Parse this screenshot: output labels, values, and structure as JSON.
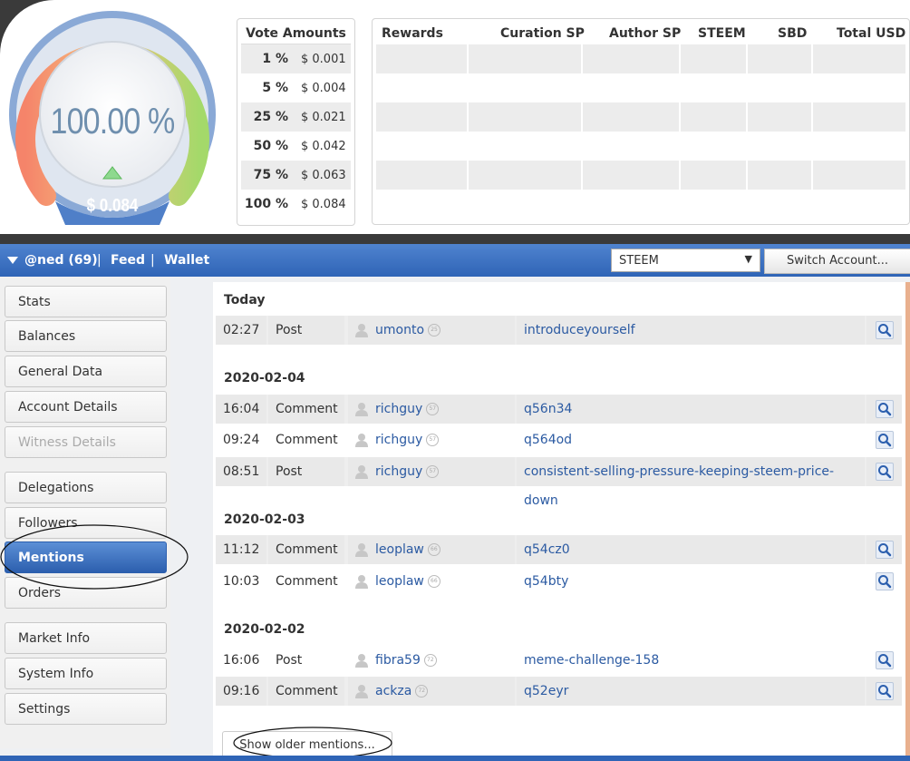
{
  "gauge": {
    "percent": "100.00 %",
    "usd": "$ 0.084",
    "arrow": "up-arrow"
  },
  "vote_amounts": {
    "title": "Vote Amounts",
    "rows": [
      {
        "pct": "1 %",
        "val": "$ 0.001"
      },
      {
        "pct": "5 %",
        "val": "$ 0.004"
      },
      {
        "pct": "25 %",
        "val": "$ 0.021"
      },
      {
        "pct": "50 %",
        "val": "$ 0.042"
      },
      {
        "pct": "75 %",
        "val": "$ 0.063"
      },
      {
        "pct": "100 %",
        "val": "$ 0.084"
      }
    ]
  },
  "rewards": {
    "headers": [
      "Rewards",
      "Curation SP",
      "Author SP",
      "STEEM",
      "SBD",
      "Total USD"
    ]
  },
  "nav": {
    "account": "@ned (69)",
    "sep": "|",
    "feed": "Feed",
    "wallet": "Wallet",
    "coin_selected": "STEEM",
    "switch_label": "Switch Account..."
  },
  "sidebar": {
    "items": [
      {
        "label": "Stats"
      },
      {
        "label": "Balances"
      },
      {
        "label": "General Data"
      },
      {
        "label": "Account Details"
      },
      {
        "label": "Witness Details"
      },
      {
        "label": "Delegations"
      },
      {
        "label": "Followers"
      },
      {
        "label": "Mentions"
      },
      {
        "label": "Orders"
      },
      {
        "label": "Market Info"
      },
      {
        "label": "System Info"
      },
      {
        "label": "Settings"
      }
    ]
  },
  "mentions": {
    "groups": [
      {
        "date": "Today",
        "rows": [
          {
            "time": "02:27",
            "type": "Post",
            "author": "umonto",
            "rep": "25",
            "link": "introduceyourself"
          }
        ]
      },
      {
        "date": "2020-02-04",
        "rows": [
          {
            "time": "16:04",
            "type": "Comment",
            "author": "richguy",
            "rep": "57",
            "link": "q56n34"
          },
          {
            "time": "09:24",
            "type": "Comment",
            "author": "richguy",
            "rep": "57",
            "link": "q564od"
          },
          {
            "time": "08:51",
            "type": "Post",
            "author": "richguy",
            "rep": "57",
            "link": "consistent-selling-pressure-keeping-steem-price-down"
          }
        ]
      },
      {
        "date": "2020-02-03",
        "rows": [
          {
            "time": "11:12",
            "type": "Comment",
            "author": "leoplaw",
            "rep": "66",
            "link": "q54cz0"
          },
          {
            "time": "10:03",
            "type": "Comment",
            "author": "leoplaw",
            "rep": "66",
            "link": "q54bty"
          }
        ]
      },
      {
        "date": "2020-02-02",
        "rows": [
          {
            "time": "16:06",
            "type": "Post",
            "author": "fibra59",
            "rep": "72",
            "link": "meme-challenge-158"
          },
          {
            "time": "09:16",
            "type": "Comment",
            "author": "ackza",
            "rep": "72",
            "link": "q52eyr"
          }
        ]
      }
    ],
    "older_label": "Show older mentions..."
  }
}
